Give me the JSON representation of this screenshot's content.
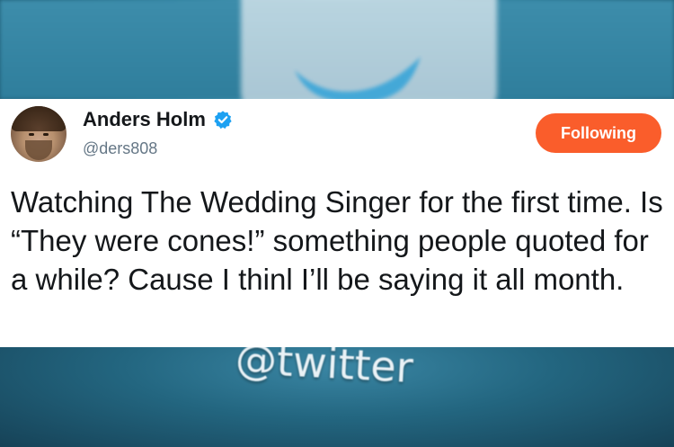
{
  "tweet": {
    "display_name": "Anders Holm",
    "username": "@ders808",
    "follow_label": "Following",
    "text": "Watching The Wedding Singer for the first time. Is “They were cones!” something people quoted for a while? Cause I thinl I’ll be saying it all month.",
    "verified": true
  },
  "background": {
    "handle_text": "@twitter"
  },
  "colors": {
    "follow_button": "#fa5d2b",
    "verified_badge": "#1da1f2",
    "background_blue": "#2f7e9c",
    "username_gray": "#657786"
  },
  "icons": {
    "bird": "twitter-bird-icon",
    "verified": "verified-badge-icon"
  }
}
